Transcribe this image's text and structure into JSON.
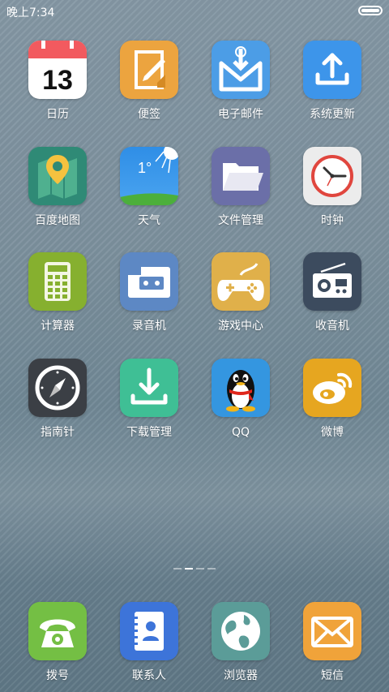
{
  "status_bar": {
    "time": "晚上7:34"
  },
  "apps": [
    {
      "key": "calendar",
      "label": "日历",
      "day": "13"
    },
    {
      "key": "notes",
      "label": "便签"
    },
    {
      "key": "email",
      "label": "电子邮件"
    },
    {
      "key": "update",
      "label": "系统更新"
    },
    {
      "key": "maps",
      "label": "百度地图"
    },
    {
      "key": "weather",
      "label": "天气",
      "temp": "1°"
    },
    {
      "key": "files",
      "label": "文件管理"
    },
    {
      "key": "clock",
      "label": "时钟"
    },
    {
      "key": "calculator",
      "label": "计算器"
    },
    {
      "key": "recorder",
      "label": "录音机"
    },
    {
      "key": "games",
      "label": "游戏中心"
    },
    {
      "key": "radio",
      "label": "收音机"
    },
    {
      "key": "compass",
      "label": "指南针"
    },
    {
      "key": "downloads",
      "label": "下载管理"
    },
    {
      "key": "qq",
      "label": "QQ"
    },
    {
      "key": "weibo",
      "label": "微博"
    }
  ],
  "dock": [
    {
      "key": "dialer",
      "label": "拨号"
    },
    {
      "key": "contacts",
      "label": "联系人"
    },
    {
      "key": "browser",
      "label": "浏览器"
    },
    {
      "key": "sms",
      "label": "短信"
    }
  ],
  "page_indicator": {
    "count": 4,
    "active_index": 1
  }
}
